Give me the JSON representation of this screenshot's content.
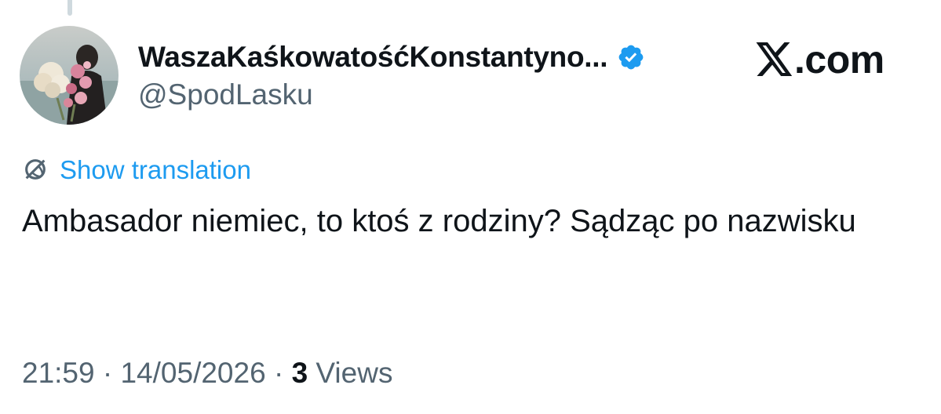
{
  "author": {
    "display_name": "WaszaKaśkowatośćKonstantyno...",
    "handle": "@SpodLasku",
    "verified": true,
    "verified_color": "#1d9bf0",
    "avatar_icon": "profile-photo-with-flowers"
  },
  "brand": {
    "text": ".com",
    "icon": "x-logo-icon"
  },
  "translation": {
    "label": "Show translation",
    "icon": "globe-icon",
    "color": "#1d9bf0"
  },
  "tweet": {
    "text": "Ambasador niemiec, to ktoś z rodziny? Sądząc po nazwisku"
  },
  "meta": {
    "time": "21:59",
    "separator": "·",
    "date": "14/05/2026",
    "views_count": "3",
    "views_label": "Views"
  },
  "colors": {
    "text_primary": "#0f1419",
    "text_secondary": "#536471",
    "accent": "#1d9bf0"
  }
}
